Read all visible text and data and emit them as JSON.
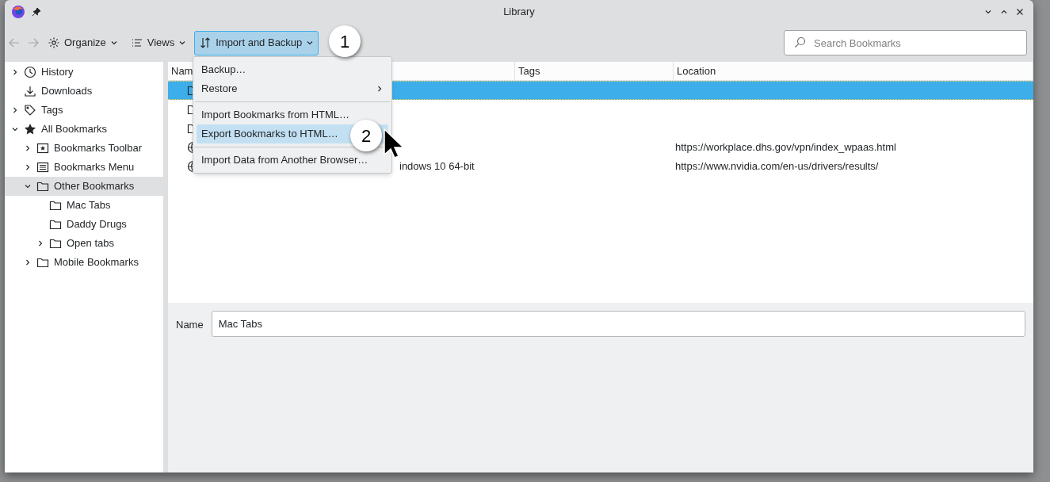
{
  "window": {
    "title": "Library"
  },
  "toolbar": {
    "buttons": [
      {
        "label": "Organize",
        "kind": "gear",
        "selected": false
      },
      {
        "label": "Views",
        "kind": "list",
        "selected": false
      },
      {
        "label": "Import and Backup",
        "kind": "sort",
        "selected": true
      }
    ],
    "search": {
      "placeholder": "Search Bookmarks"
    }
  },
  "menu": {
    "items": [
      {
        "label": "Backup…",
        "kind": "item",
        "selected": false
      },
      {
        "label": "Restore",
        "kind": "submenu",
        "selected": false
      },
      {
        "kind": "separator"
      },
      {
        "label": "Import Bookmarks from HTML…",
        "kind": "item",
        "selected": false
      },
      {
        "label": "Export Bookmarks to HTML…",
        "kind": "item",
        "selected": true
      },
      {
        "kind": "separator"
      },
      {
        "label": "Import Data from Another Browser…",
        "kind": "item",
        "selected": false
      }
    ]
  },
  "callouts": [
    "1",
    "2"
  ],
  "sidebar": {
    "items": [
      {
        "label": "History",
        "kind": "clock",
        "expanded": false,
        "selected": false
      },
      {
        "label": "Downloads",
        "kind": "download",
        "selected": false
      },
      {
        "label": "Tags",
        "kind": "tag",
        "expanded": false,
        "selected": false
      },
      {
        "label": "All Bookmarks",
        "kind": "star",
        "expanded": true,
        "selected": false,
        "children": [
          {
            "label": "Bookmarks Toolbar",
            "kind": "toolbar",
            "expanded": false,
            "selected": false
          },
          {
            "label": "Bookmarks Menu",
            "kind": "menu",
            "expanded": false,
            "selected": false
          },
          {
            "label": "Other Bookmarks",
            "kind": "folder",
            "expanded": true,
            "selected": true,
            "children": [
              {
                "label": "Mac Tabs",
                "kind": "folder",
                "selected": false
              },
              {
                "label": "Daddy Drugs",
                "kind": "folder",
                "selected": false
              },
              {
                "label": "Open tabs",
                "kind": "folder",
                "expanded": false,
                "selected": false
              }
            ]
          },
          {
            "label": "Mobile Bookmarks",
            "kind": "folder",
            "expanded": false,
            "selected": false
          }
        ]
      }
    ]
  },
  "table": {
    "columns": [
      "Nam",
      "Tags",
      "Location"
    ],
    "rows": [
      {
        "kind": "folder",
        "selected": true
      },
      {
        "kind": "folder",
        "selected": false
      },
      {
        "kind": "folder",
        "selected": false
      },
      {
        "kind": "globe",
        "selected": false,
        "location": "https://workplace.dhs.gov/vpn/index_wpaas.html"
      },
      {
        "kind": "globe",
        "selected": false,
        "name": "indows 10 64-bit",
        "location": "https://www.nvidia.com/en-us/drivers/results/"
      }
    ]
  },
  "details": {
    "name_label": "Name",
    "name_value": "Mac Tabs"
  }
}
